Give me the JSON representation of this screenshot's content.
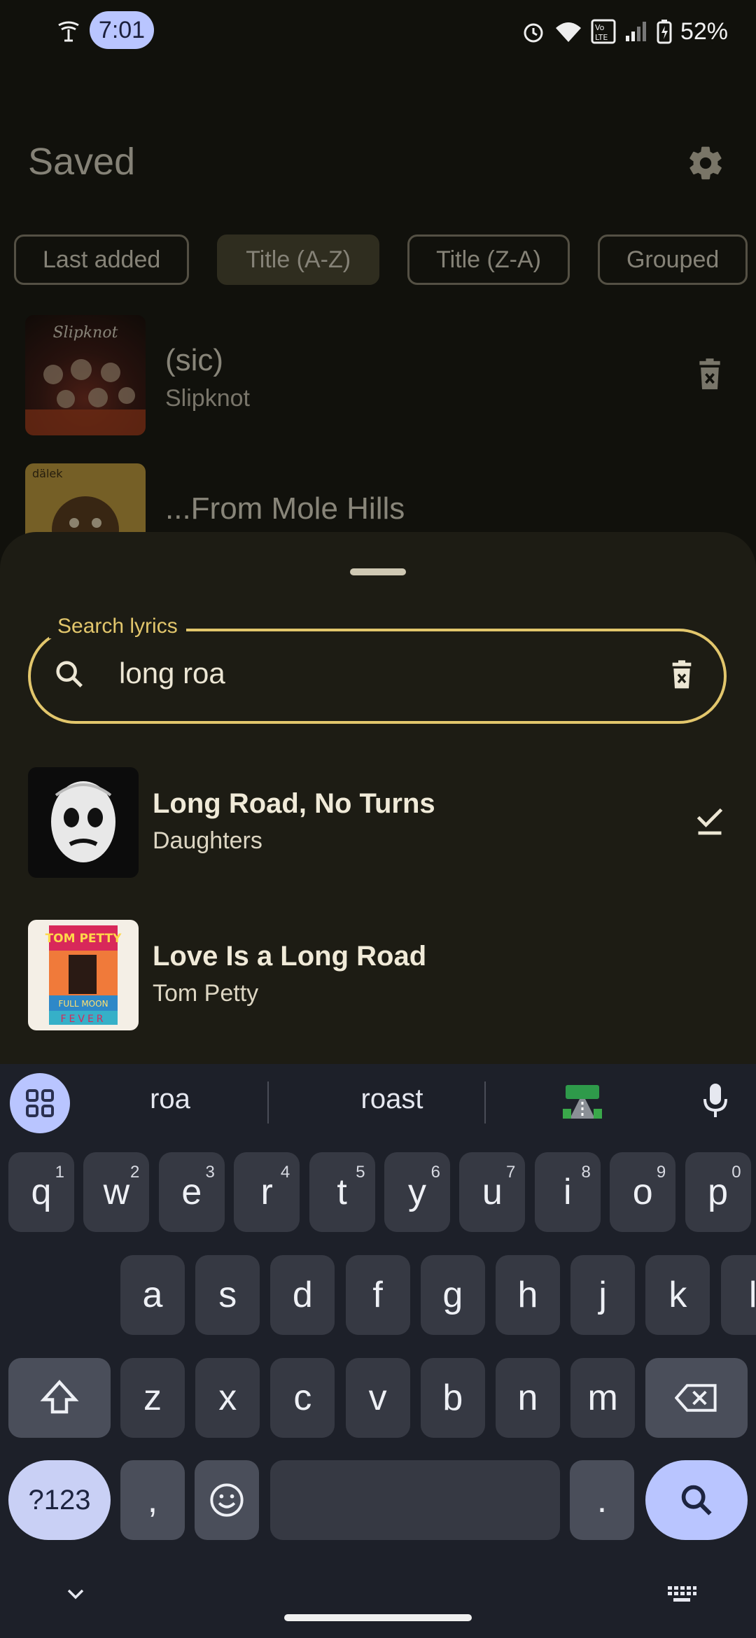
{
  "status_bar": {
    "time": "7:01",
    "battery": "52%"
  },
  "header": {
    "title": "Saved"
  },
  "chips": [
    {
      "label": "Last added",
      "selected": false
    },
    {
      "label": "Title (A-Z)",
      "selected": true
    },
    {
      "label": "Title (Z-A)",
      "selected": false
    },
    {
      "label": "Grouped",
      "selected": false
    }
  ],
  "saved": [
    {
      "title": "(sic)",
      "artist": "Slipknot",
      "cover_text": "Slipknot"
    },
    {
      "title": "...From Mole Hills",
      "artist": "",
      "cover_text": "dälek"
    }
  ],
  "search": {
    "label": "Search lyrics",
    "value": "long roa"
  },
  "results": [
    {
      "title": "Long Road, No Turns",
      "artist": "Daughters",
      "saved": true
    },
    {
      "title": "Love Is a Long Road",
      "artist": "Tom Petty",
      "saved": false,
      "cover_top": "TOM PETTY",
      "cover_mid": "FULL MOON",
      "cover_bottom": "FEVER"
    }
  ],
  "keyboard": {
    "suggestions": [
      "roa",
      "roast"
    ],
    "row1": [
      {
        "k": "q",
        "h": "1"
      },
      {
        "k": "w",
        "h": "2"
      },
      {
        "k": "e",
        "h": "3"
      },
      {
        "k": "r",
        "h": "4"
      },
      {
        "k": "t",
        "h": "5"
      },
      {
        "k": "y",
        "h": "6"
      },
      {
        "k": "u",
        "h": "7"
      },
      {
        "k": "i",
        "h": "8"
      },
      {
        "k": "o",
        "h": "9"
      },
      {
        "k": "p",
        "h": "0"
      }
    ],
    "row2": [
      "a",
      "s",
      "d",
      "f",
      "g",
      "h",
      "j",
      "k",
      "l"
    ],
    "row3": [
      "z",
      "x",
      "c",
      "v",
      "b",
      "n",
      "m"
    ],
    "sym": "?123",
    "comma": ",",
    "period": "."
  },
  "colors": {
    "accent": "#e2c66c",
    "keyboard_accent": "#b9c5ff"
  }
}
